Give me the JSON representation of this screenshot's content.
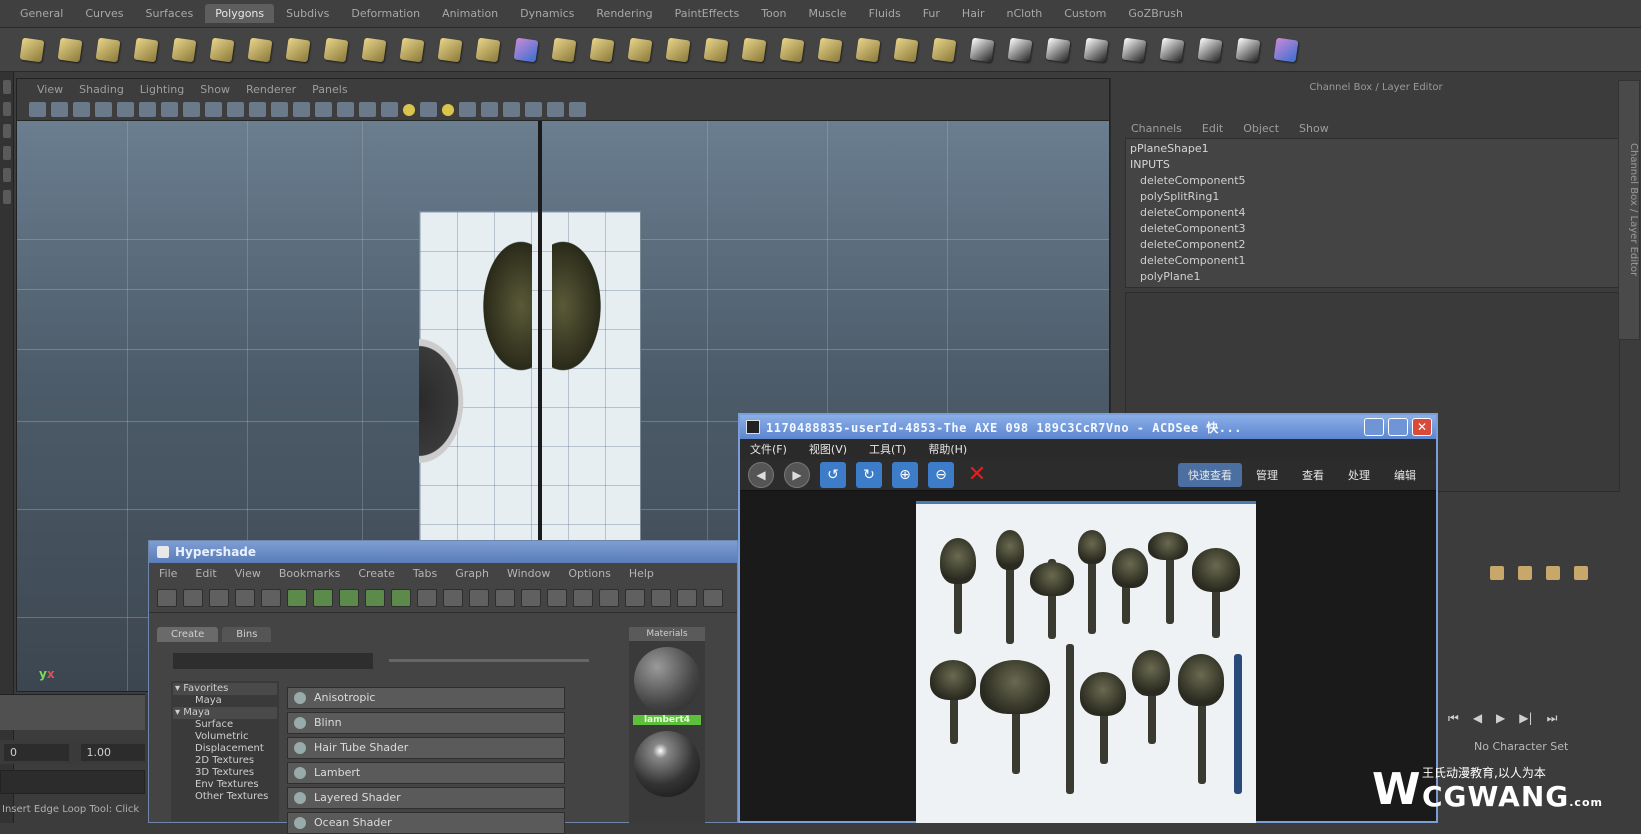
{
  "shelf": {
    "tabs": [
      "General",
      "Curves",
      "Surfaces",
      "Polygons",
      "Subdivs",
      "Deformation",
      "Animation",
      "Dynamics",
      "Rendering",
      "PaintEffects",
      "Toon",
      "Muscle",
      "Fluids",
      "Fur",
      "Hair",
      "nCloth",
      "Custom",
      "GoZBrush"
    ],
    "active_tab": "Polygons"
  },
  "viewport": {
    "menu": [
      "View",
      "Shading",
      "Lighting",
      "Show",
      "Renderer",
      "Panels"
    ],
    "axis_y": "y",
    "axis_x": "x"
  },
  "channel_box": {
    "title": "Channel Box / Layer Editor",
    "menu": [
      "Channels",
      "Edit",
      "Object",
      "Show"
    ],
    "shape_node": "pPlaneShape1",
    "inputs_label": "INPUTS",
    "inputs": [
      "deleteComponent5",
      "polySplitRing1",
      "deleteComponent4",
      "deleteComponent3",
      "deleteComponent2",
      "deleteComponent1",
      "polyPlane1"
    ],
    "side_tab": "Channel Box / Layer Editor"
  },
  "timeline": {
    "range_start": "1.00",
    "range_field_left": "0",
    "char_set": "No Character Set",
    "help_line": "Insert Edge Loop Tool: Click"
  },
  "hypershade": {
    "title": "Hypershade",
    "menu": [
      "File",
      "Edit",
      "View",
      "Bookmarks",
      "Create",
      "Tabs",
      "Graph",
      "Window",
      "Options",
      "Help"
    ],
    "tabs": [
      "Create",
      "Bins"
    ],
    "material_tab": "Materials",
    "tree": [
      {
        "label": "Favorites",
        "group": true
      },
      {
        "label": "Maya",
        "group": false
      },
      {
        "label": "Maya",
        "group": true
      },
      {
        "label": "Surface",
        "group": false
      },
      {
        "label": "Volumetric",
        "group": false
      },
      {
        "label": "Displacement",
        "group": false
      },
      {
        "label": "2D Textures",
        "group": false
      },
      {
        "label": "3D Textures",
        "group": false
      },
      {
        "label": "Env Textures",
        "group": false
      },
      {
        "label": "Other Textures",
        "group": false
      }
    ],
    "nodes": [
      "Anisotropic",
      "Blinn",
      "Hair Tube Shader",
      "Lambert",
      "Layered Shader",
      "Ocean Shader"
    ],
    "lambert_label": "lambert4"
  },
  "acdsee": {
    "title": "1170488835-userId-4853-The AXE 098 189C3CcR7Vno - ACDSee 快...",
    "menu": [
      "文件(F)",
      "视图(V)",
      "工具(T)",
      "帮助(H)"
    ],
    "modes": [
      "快速查看",
      "管理",
      "查看",
      "处理",
      "编辑"
    ],
    "active_mode": "快速查看",
    "close_glyph": "✕"
  },
  "watermark": {
    "tagline": "王氏动漫教育,以人为本",
    "name": "CGWANG",
    "suffix": ".com",
    "logo": "W"
  }
}
